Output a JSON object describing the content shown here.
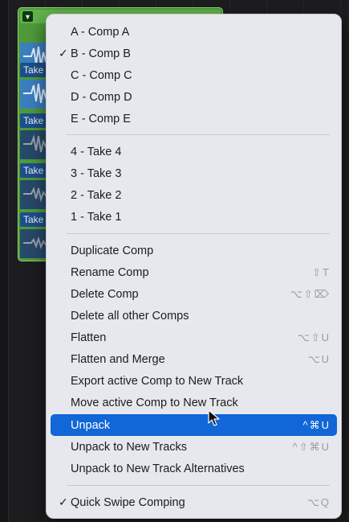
{
  "take_folder": {
    "takes": [
      "Take",
      "Take",
      "Take",
      "Take"
    ]
  },
  "menu": {
    "comps": [
      {
        "label": "A - Comp A",
        "checked": false
      },
      {
        "label": "B - Comp B",
        "checked": true
      },
      {
        "label": "C - Comp C",
        "checked": false
      },
      {
        "label": "D - Comp D",
        "checked": false
      },
      {
        "label": "E - Comp E",
        "checked": false
      }
    ],
    "takes": [
      {
        "label": "4 - Take 4"
      },
      {
        "label": "3 - Take 3"
      },
      {
        "label": "2 - Take 2"
      },
      {
        "label": "1 - Take 1"
      }
    ],
    "actions": [
      {
        "label": "Duplicate Comp",
        "shortcut": ""
      },
      {
        "label": "Rename Comp",
        "shortcut": "⇧T"
      },
      {
        "label": "Delete Comp",
        "shortcut": "⌥⇧⌦"
      },
      {
        "label": "Delete all other Comps",
        "shortcut": ""
      },
      {
        "label": "Flatten",
        "shortcut": "⌥⇧U"
      },
      {
        "label": "Flatten and Merge",
        "shortcut": "⌥U"
      },
      {
        "label": "Export active Comp to New Track",
        "shortcut": ""
      },
      {
        "label": "Move active Comp to New Track",
        "shortcut": ""
      },
      {
        "label": "Unpack",
        "shortcut": "^⌘U",
        "highlighted": true
      },
      {
        "label": "Unpack to New Tracks",
        "shortcut": "^⇧⌘U"
      },
      {
        "label": "Unpack to New Track Alternatives",
        "shortcut": ""
      }
    ],
    "options": [
      {
        "label": "Quick Swipe Comping",
        "checked": true,
        "shortcut": "⌥Q"
      }
    ],
    "check_glyph": "✓"
  },
  "colors": {
    "highlight": "#1166d8",
    "take_folder": "#4f9a3a",
    "take_region": "#3b7fc0",
    "menu_bg": "#e7e8ee"
  }
}
